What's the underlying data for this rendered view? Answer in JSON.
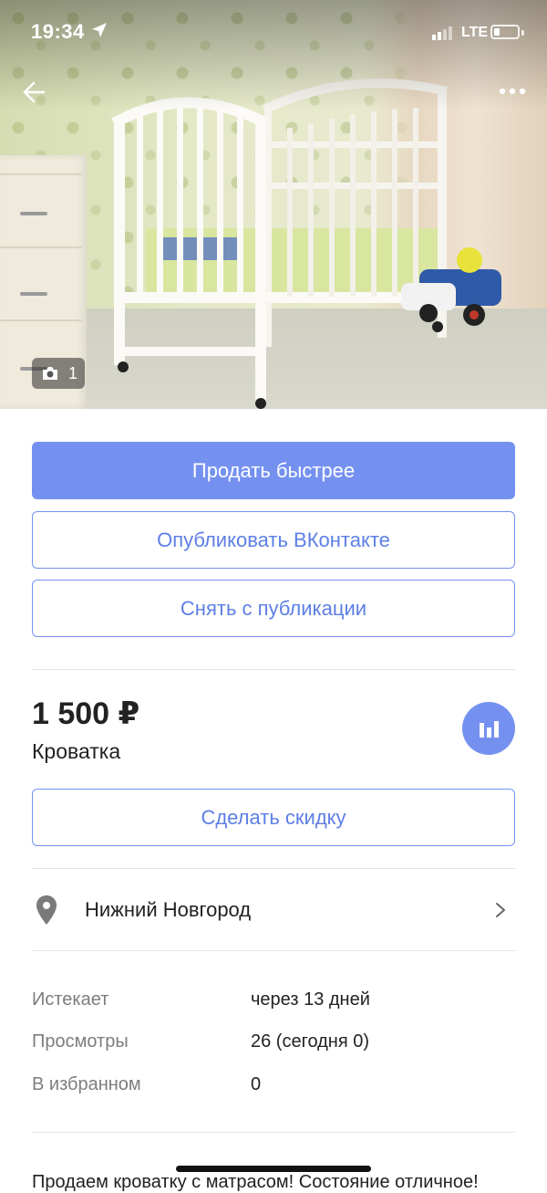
{
  "status_bar": {
    "time": "19:34",
    "network": "LTE"
  },
  "photo": {
    "count": "1",
    "subject": "crib photo"
  },
  "actions": {
    "sell_faster": "Продать быстрее",
    "publish_vk": "Опубликовать ВКонтакте",
    "unpublish": "Снять с публикации",
    "discount": "Сделать скидку"
  },
  "listing": {
    "price": "1 500 ₽",
    "title": "Кроватка"
  },
  "location": {
    "city": "Нижний Новгород"
  },
  "meta": [
    {
      "label": "Истекает",
      "value": "через 13 дней"
    },
    {
      "label": "Просмотры",
      "value": "26 (сегодня 0)"
    },
    {
      "label": "В избранном",
      "value": "0"
    }
  ],
  "description": "Продаем кроватку с матрасом! Состояние отличное!",
  "colors": {
    "accent": "#7591f0",
    "accent_text": "#5d7fe5"
  },
  "icons": [
    "back-arrow-icon",
    "more-dots-icon",
    "camera-icon",
    "stats-chart-icon",
    "location-pin-icon",
    "chevron-right-icon",
    "location-arrow-icon"
  ]
}
